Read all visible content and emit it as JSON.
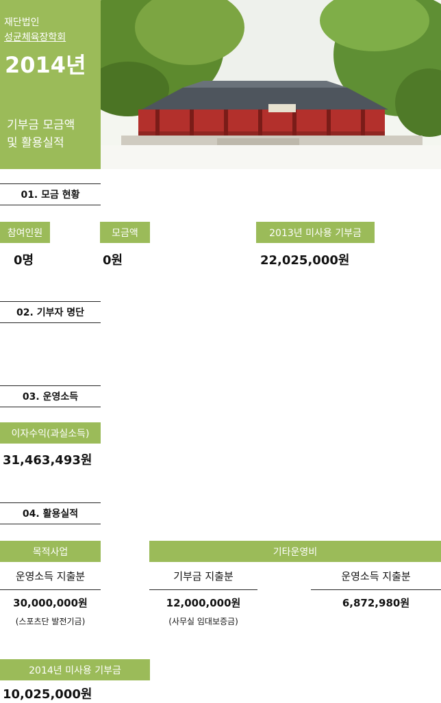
{
  "header": {
    "org_line1": "재단법인",
    "org_line2": "성균체육장학회",
    "year": "2014년",
    "subtitle_line1": "기부금 모금액",
    "subtitle_line2": "및 활용실적"
  },
  "section1": {
    "title": "01. 모금 현황",
    "participants_label": "참여인원",
    "participants_value": "0명",
    "amount_label": "모금액",
    "amount_value": "0원",
    "unused2013_label": "2013년 미사용 기부금",
    "unused2013_value": "22,025,000원"
  },
  "section2": {
    "title": "02. 기부자 명단"
  },
  "section3": {
    "title": "03. 운영소득",
    "interest_label": "이자수익(과실소득)",
    "interest_value": "31,463,493원"
  },
  "section4": {
    "title": "04. 활용실적",
    "purpose_label": "목적사업",
    "other_label": "기타운영비",
    "col1_header": "운영소득 지출분",
    "col1_value": "30,000,000원",
    "col1_note": "(스포츠단 발전기금)",
    "col2_header": "기부금 지출분",
    "col2_value": "12,000,000원",
    "col2_note": "(사무실 임대보증금)",
    "col3_header": "운영소득 지출분",
    "col3_value": "6,872,980원"
  },
  "unused2014": {
    "label": "2014년 미사용 기부금",
    "value": "10,025,000원"
  },
  "colors": {
    "accent": "#9bbb59"
  }
}
